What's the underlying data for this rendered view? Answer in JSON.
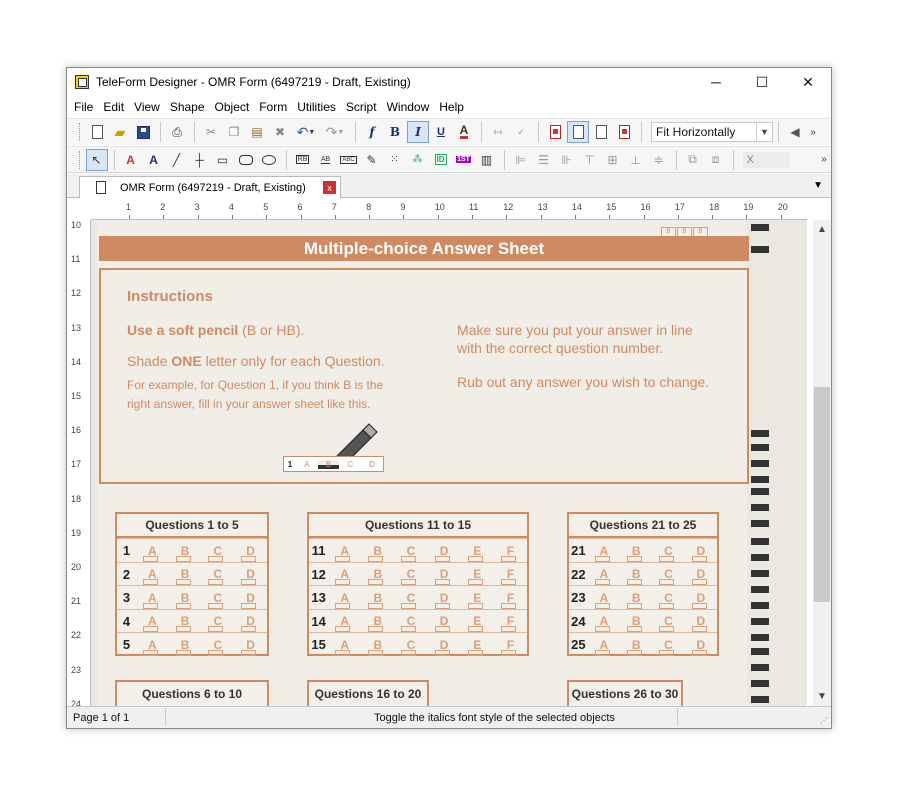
{
  "window": {
    "title": "TeleForm Designer - OMR Form (6497219 - Draft, Existing)",
    "min_glyph": "─",
    "max_glyph": "☐",
    "close_glyph": "✕"
  },
  "menu": [
    "File",
    "Edit",
    "View",
    "Shape",
    "Object",
    "Form",
    "Utilities",
    "Script",
    "Window",
    "Help"
  ],
  "toolbar1": {
    "zoom_value": "Fit Horizontally",
    "bold": "B",
    "italic": "I",
    "underline": "U",
    "font_color": "A",
    "font_f": "f"
  },
  "toolbar2": {
    "coord_placeholder": "X",
    "text_a": "A",
    "text_b": "A",
    "tools": [
      "RB",
      "AB",
      "ABC",
      "ID",
      "1ST"
    ]
  },
  "tab": {
    "label": "OMR Form (6497219 - Draft, Existing)",
    "close": "x"
  },
  "ruler": {
    "h": [
      "1",
      "2",
      "3",
      "4",
      "5",
      "6",
      "7",
      "8",
      "9",
      "10",
      "11",
      "12",
      "13",
      "14",
      "15",
      "16",
      "17",
      "18",
      "19",
      "20"
    ],
    "v": [
      "10",
      "11",
      "12",
      "13",
      "14",
      "15",
      "16",
      "17",
      "18",
      "19",
      "20",
      "21",
      "22",
      "23",
      "24"
    ]
  },
  "status": {
    "page": "Page 1 of 1",
    "message": "Toggle the italics font style of the selected objects"
  },
  "form": {
    "banner": "Multiple-choice Answer Sheet",
    "instructions_title": "Instructions",
    "line1_bold": "Use a soft pencil",
    "line1_rest": " (B or HB).",
    "line2_a": "Shade ",
    "line2_bold": "ONE",
    "line2_b": " letter only for each Question.",
    "line3": "For example, for Question 1, if you think B is the",
    "line4": "right answer, fill in your answer sheet like this.",
    "right1": "Make sure you put your answer in line",
    "right2": "with the correct question number.",
    "right3": "Rub out any answer you wish to change.",
    "example_num": "1",
    "example_opts": [
      "A",
      "B",
      "C",
      "D"
    ],
    "top_hint": [
      "9",
      "9",
      "9"
    ],
    "groups": [
      {
        "title": "Questions 1 to 5",
        "start": 1,
        "options": [
          "A",
          "B",
          "C",
          "D"
        ]
      },
      {
        "title": "Questions 11 to 15",
        "start": 11,
        "options": [
          "A",
          "B",
          "C",
          "D",
          "E",
          "F"
        ]
      },
      {
        "title": "Questions 21 to 25",
        "start": 21,
        "options": [
          "A",
          "B",
          "C",
          "D"
        ]
      }
    ],
    "groups_next": [
      "Questions 6 to 10",
      "Questions 16 to 20",
      "Questions 26 to 30"
    ]
  }
}
